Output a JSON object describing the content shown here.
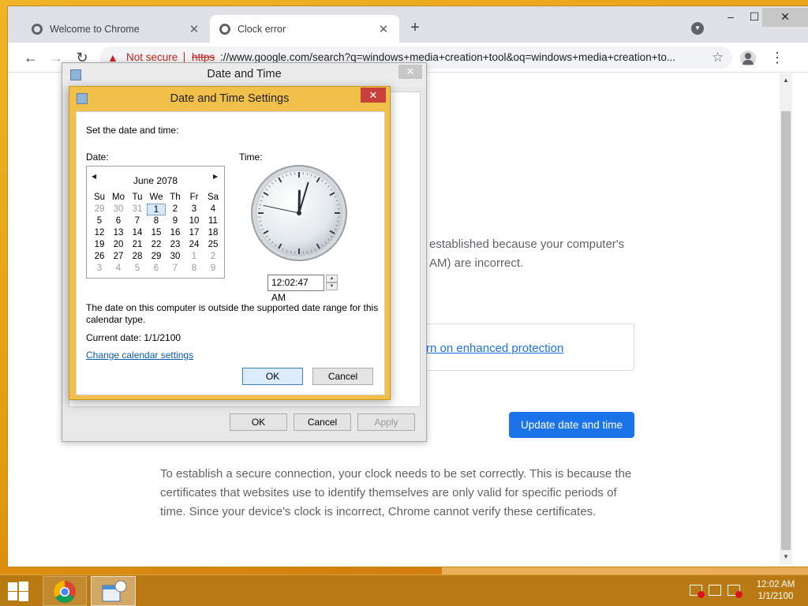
{
  "browser": {
    "tabs": [
      {
        "title": "Welcome to Chrome"
      },
      {
        "title": "Clock error"
      }
    ],
    "omnibox": {
      "security_label": "Not secure",
      "url_scheme": "https",
      "url_rest": "://www.google.com/search?q=windows+media+creation+tool&oq=windows+media+creation+to..."
    }
  },
  "error_page": {
    "partial_line1": "established because your computer's",
    "partial_line2": "AM) are incorrect.",
    "enhanced_link": "rn on enhanced protection",
    "update_button": "Update date and time",
    "explanation": "To establish a secure connection, your clock needs to be set correctly. This is because the certificates that websites use to identify themselves are only valid for specific periods of time. Since your device's clock is incorrect, Chrome cannot verify these certificates."
  },
  "date_time_dialog": {
    "title": "Date and Time",
    "ok": "OK",
    "cancel": "Cancel",
    "apply": "Apply"
  },
  "settings_dialog": {
    "title": "Date and Time Settings",
    "set_label": "Set the date and time:",
    "date_label": "Date:",
    "time_label": "Time:",
    "calendar": {
      "month": "June 2078",
      "weekdays": [
        "Su",
        "Mo",
        "Tu",
        "We",
        "Th",
        "Fr",
        "Sa"
      ],
      "weeks": [
        [
          "29",
          "30",
          "31",
          "1",
          "2",
          "3",
          "4"
        ],
        [
          "5",
          "6",
          "7",
          "8",
          "9",
          "10",
          "11"
        ],
        [
          "12",
          "13",
          "14",
          "15",
          "16",
          "17",
          "18"
        ],
        [
          "19",
          "20",
          "21",
          "22",
          "23",
          "24",
          "25"
        ],
        [
          "26",
          "27",
          "28",
          "29",
          "30",
          "1",
          "2"
        ],
        [
          "3",
          "4",
          "5",
          "6",
          "7",
          "8",
          "9"
        ]
      ],
      "selected_day": "1"
    },
    "clock": {
      "hour": 12,
      "minute": 2,
      "second": 47
    },
    "time_value": "12:02:47 AM",
    "range_message": "The date on this computer is outside the supported date range for this calendar type.",
    "current_date": "Current date: 1/1/2100",
    "calendar_link": "Change calendar settings",
    "ok": "OK",
    "cancel": "Cancel"
  },
  "taskbar": {
    "time": "12:02 AM",
    "date": "1/1/2100"
  },
  "colors": {
    "accent": "#1a73e8",
    "warning": "#c5221f",
    "dialog_frame": "#f0c04a"
  }
}
